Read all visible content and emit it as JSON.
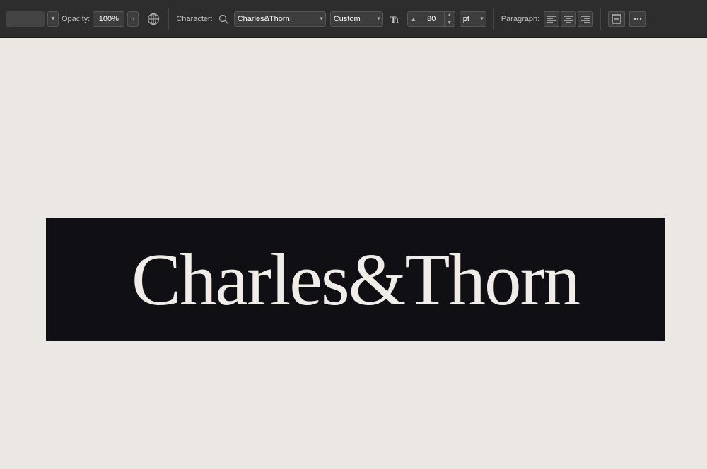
{
  "toolbar": {
    "opacity_label": "Opacity:",
    "opacity_value": "100%",
    "character_label": "Character:",
    "font_name": "Charles&Thorn",
    "style_value": "Custom",
    "font_size_value": "80",
    "font_size_unit": "pt",
    "paragraph_label": "Paragraph:",
    "align_left_label": "Align Left",
    "align_center_label": "Align Center",
    "align_right_label": "Align Right",
    "more_options_label": "More Options"
  },
  "canvas": {
    "banner_text": "Charles&Thorn",
    "background_color": "#ebe8e3",
    "banner_bg": "#0f0f14",
    "banner_text_color": "#f0ede8"
  }
}
